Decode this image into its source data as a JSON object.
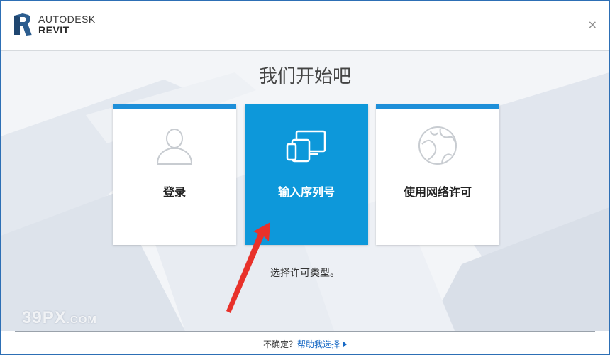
{
  "app": {
    "brand": "AUTODESK",
    "product": "REVIT"
  },
  "window": {
    "close_glyph": "×"
  },
  "main": {
    "heading": "我们开始吧",
    "hint": "选择许可类型。"
  },
  "cards": [
    {
      "label": "登录",
      "icon": "user-icon",
      "active": false
    },
    {
      "label": "输入序列号",
      "icon": "devices-icon",
      "active": true
    },
    {
      "label": "使用网络许可",
      "icon": "network-globe-icon",
      "active": false
    }
  ],
  "footer": {
    "question": "不确定？",
    "help_link": "帮助我选择"
  },
  "watermark": {
    "text": "39PX",
    "suffix": ".COM"
  },
  "colors": {
    "accent": "#0d98da",
    "card_bar": "#1d8fd9",
    "link": "#1769c5",
    "arrow": "#e8312a"
  }
}
